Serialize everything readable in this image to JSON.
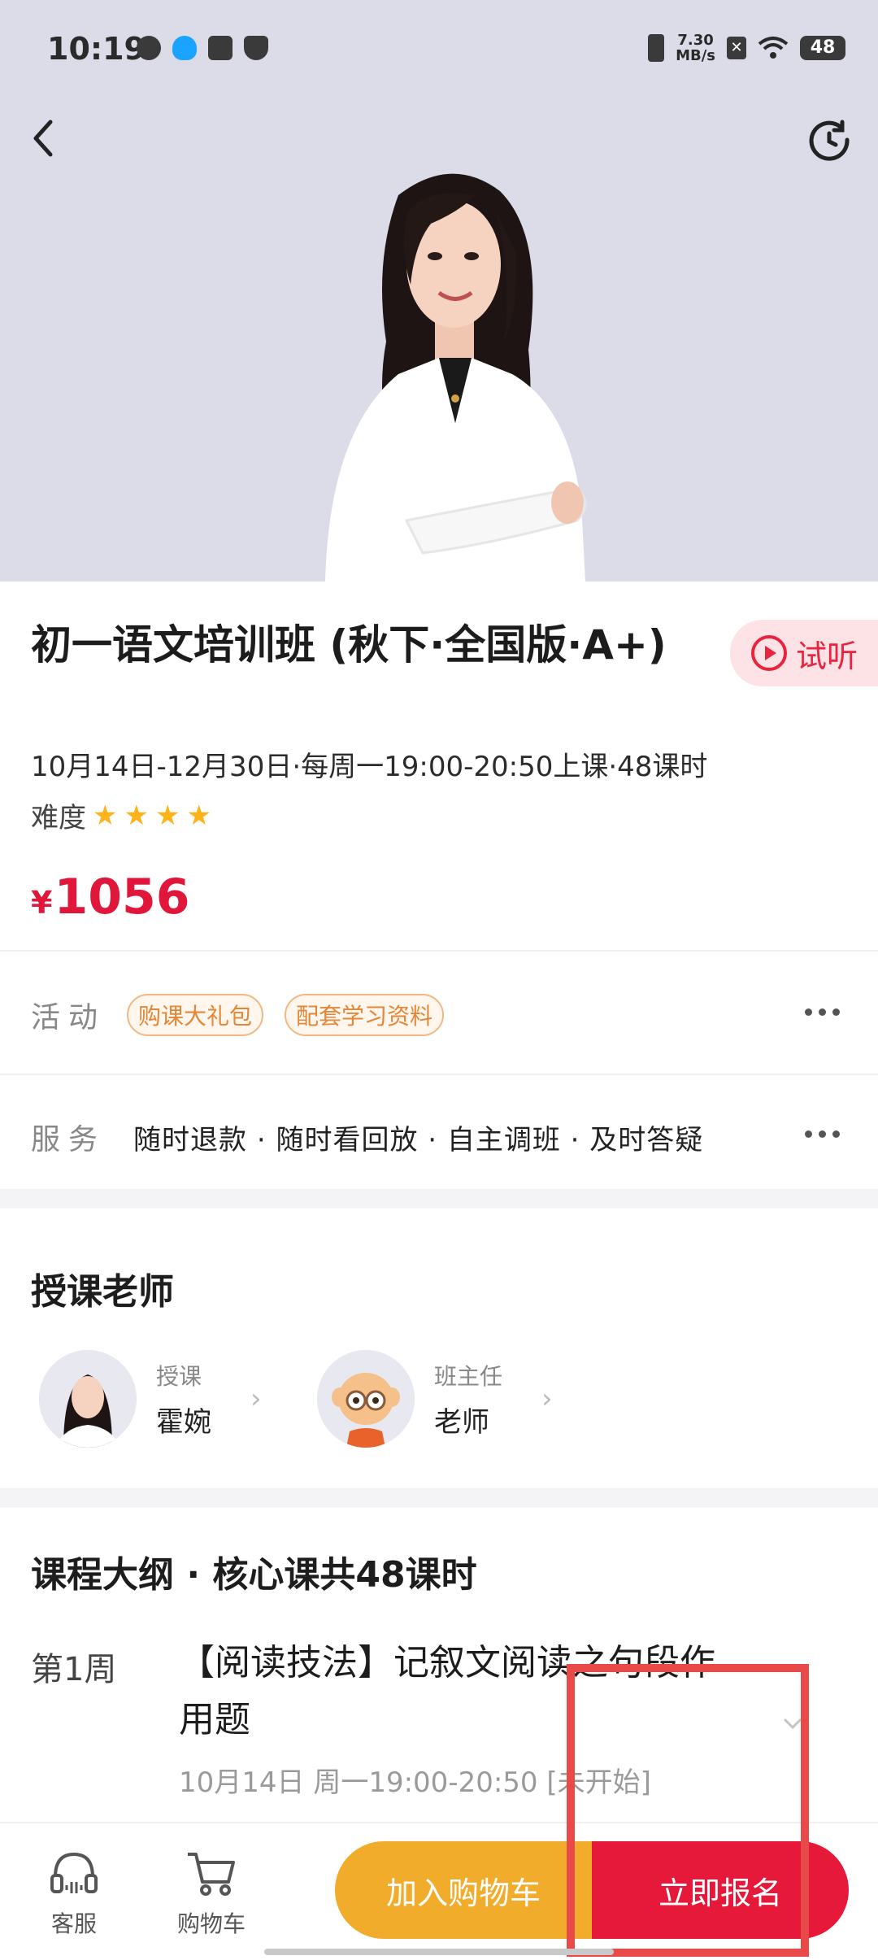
{
  "status_bar": {
    "time": "10:19",
    "network_speed": "7.30\nMB/s",
    "battery": "48",
    "icons": [
      "app-icon-1",
      "qq-icon",
      "mail-icon",
      "shield-icon",
      "vibrate-icon",
      "sim-icon",
      "wifi-icon",
      "battery-icon"
    ]
  },
  "header": {
    "back_icon": "chevron-left-icon",
    "history_icon": "history-icon"
  },
  "course": {
    "title": "初一语文培训班 (秋下·全国版·A+)",
    "trial_label": "试听",
    "schedule": "10月14日-12月30日·每周一19:00-20:50上课·48课时",
    "difficulty_label": "难度",
    "difficulty_stars": 4,
    "price_symbol": "¥",
    "price": "1056"
  },
  "activities": {
    "label": "活动",
    "tags": [
      "购课大礼包",
      "配套学习资料"
    ]
  },
  "services": {
    "label": "服务",
    "text": "随时退款 · 随时看回放 · 自主调班 · 及时答疑"
  },
  "teachers": {
    "section_title": "授课老师",
    "items": [
      {
        "role": "授课",
        "name": "霍婉"
      },
      {
        "role": "班主任",
        "name": "老师"
      }
    ]
  },
  "syllabus": {
    "section_title": "课程大纲 · 核心课共48课时",
    "week": "第1周",
    "lesson_title": "【阅读技法】记叙文阅读之句段作用题",
    "lesson_time": "10月14日 周一19:00-20:50 [未开始]"
  },
  "bottom_bar": {
    "service_label": "客服",
    "cart_label": "购物车",
    "add_to_cart": "加入购物车",
    "enroll_now": "立即报名"
  },
  "colors": {
    "accent_red": "#e7193a",
    "accent_orange": "#f2ac2c",
    "star": "#ffb21a",
    "hero_bg": "#dcdce9"
  }
}
